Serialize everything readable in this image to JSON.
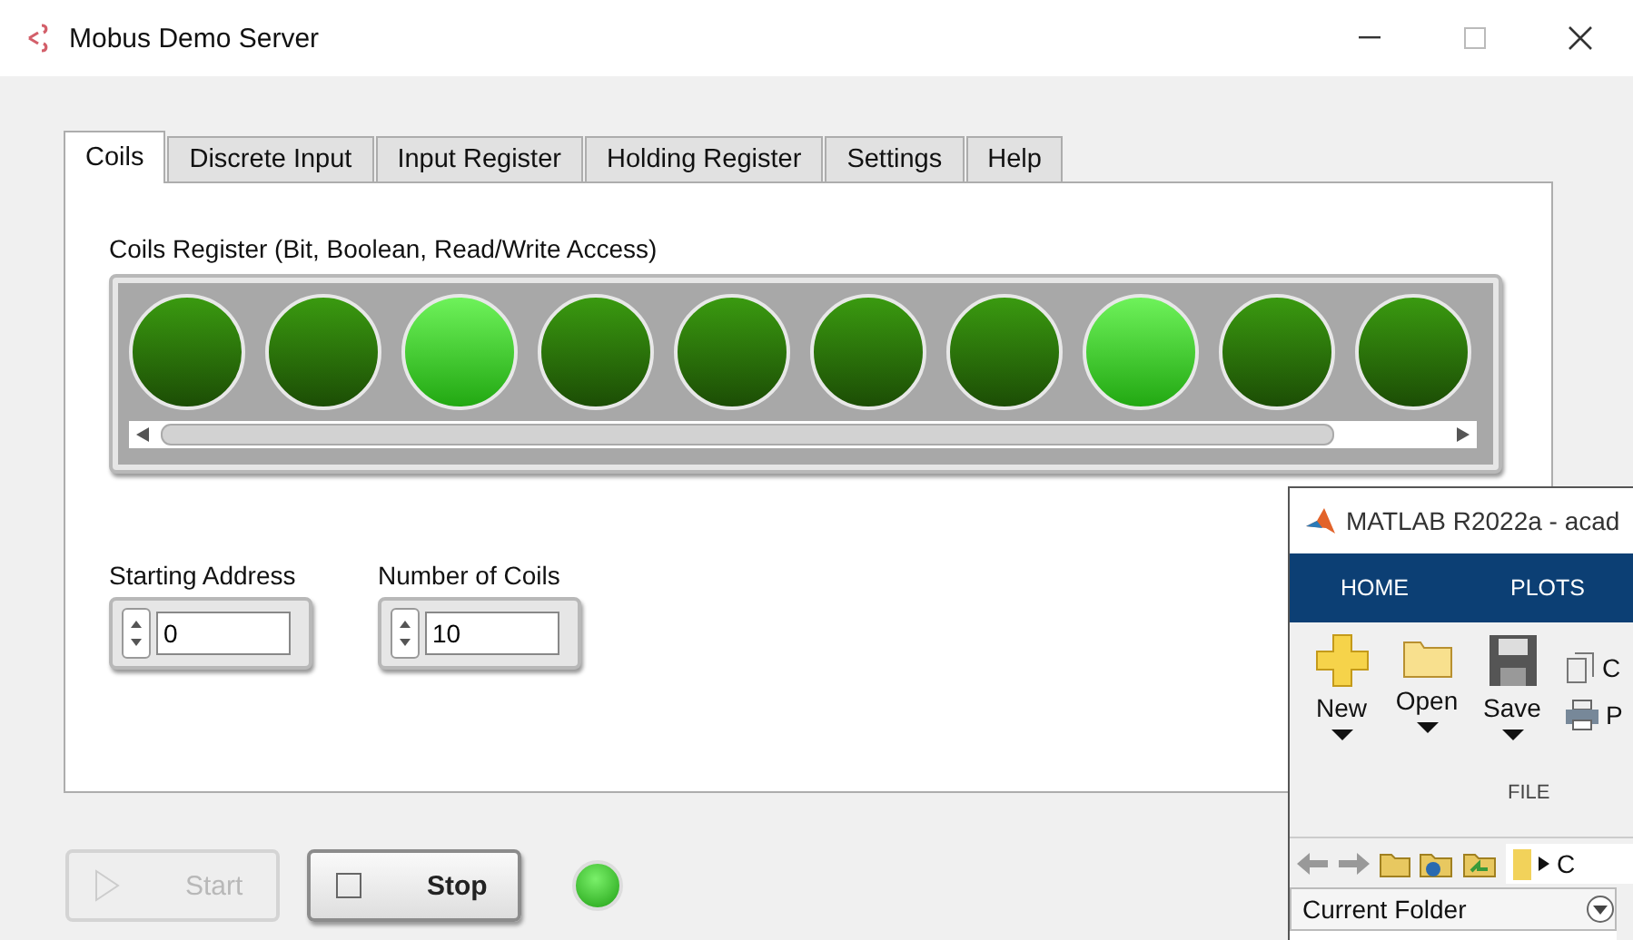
{
  "window": {
    "title": "Mobus Demo Server"
  },
  "tabs": [
    {
      "label": "Coils",
      "selected": true
    },
    {
      "label": "Discrete Input",
      "selected": false
    },
    {
      "label": "Input Register",
      "selected": false
    },
    {
      "label": "Holding Register",
      "selected": false
    },
    {
      "label": "Settings",
      "selected": false
    },
    {
      "label": "Help",
      "selected": false
    }
  ],
  "coils_panel": {
    "title": "Coils Register (Bit, Boolean, Read/Write Access)",
    "coils": [
      {
        "on": false
      },
      {
        "on": false
      },
      {
        "on": true
      },
      {
        "on": false
      },
      {
        "on": false
      },
      {
        "on": false
      },
      {
        "on": false
      },
      {
        "on": true
      },
      {
        "on": false
      },
      {
        "on": false
      }
    ]
  },
  "fields": [
    {
      "label": "Starting Address",
      "value": "0"
    },
    {
      "label": "Number of Coils",
      "value": "10"
    }
  ],
  "buttons": [
    {
      "label": "Start",
      "kind": "start",
      "disabled": true
    },
    {
      "label": "Stop",
      "kind": "stop",
      "disabled": false
    }
  ],
  "status_led": {
    "on": true
  },
  "matlab_window": {
    "title": "MATLAB R2022a - acad",
    "tabs": [
      {
        "label": "HOME"
      },
      {
        "label": "PLOTS"
      }
    ],
    "tools": [
      {
        "label": "New",
        "kind": "new"
      },
      {
        "label": "Open",
        "kind": "open"
      },
      {
        "label": "Save",
        "kind": "save"
      }
    ],
    "side_tools": [
      {
        "label": "C",
        "kind": "compare"
      },
      {
        "label": "P",
        "kind": "print"
      }
    ],
    "section_label": "FILE",
    "path": "C",
    "panel_title": "Current Folder"
  }
}
